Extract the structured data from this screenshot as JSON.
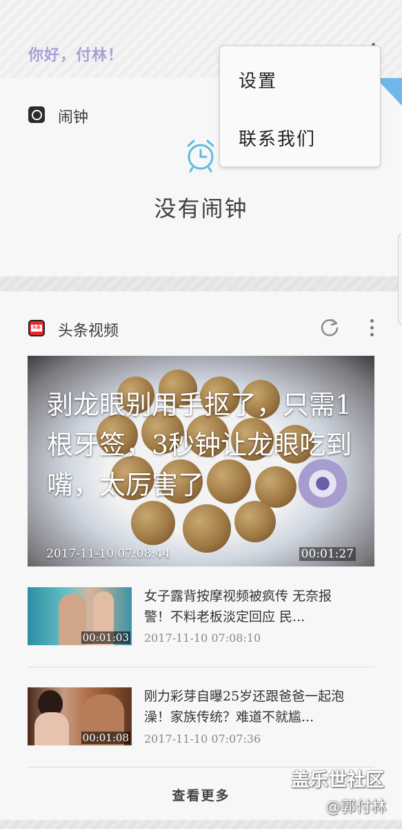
{
  "header": {
    "greeting": "你好，付林！"
  },
  "menu": {
    "items": [
      "设置",
      "联系我们"
    ]
  },
  "alarm_card": {
    "title": "闹钟",
    "empty_text": "没有闹钟"
  },
  "news_card": {
    "title": "头条视频",
    "app_icon_text": "头条",
    "featured": {
      "title": "剥龙眼别用手抠了，只需1根牙签，3秒钟让龙眼吃到嘴，太厉害了",
      "time": "2017-11-10 07:08:44",
      "duration": "00:01:27"
    },
    "items": [
      {
        "title": "女子露背按摩视频被疯传 无奈报警！不料老板淡定回应 民...",
        "time": "2017-11-10 07:08:10",
        "duration": "00:01:03"
      },
      {
        "title": "刚力彩芽自曝25岁还跟爸爸一起泡澡！家族传统？难道不就尴...",
        "time": "2017-11-10 07:07:36",
        "duration": "00:01:08"
      }
    ],
    "see_more": "查看更多"
  },
  "watermark": {
    "line1": "盖乐世社区",
    "line2": "@郭付林"
  },
  "colors": {
    "greeting": "#a7a1d8",
    "accent": "#6db8e8",
    "alarm_icon": "#5fb9e0"
  }
}
